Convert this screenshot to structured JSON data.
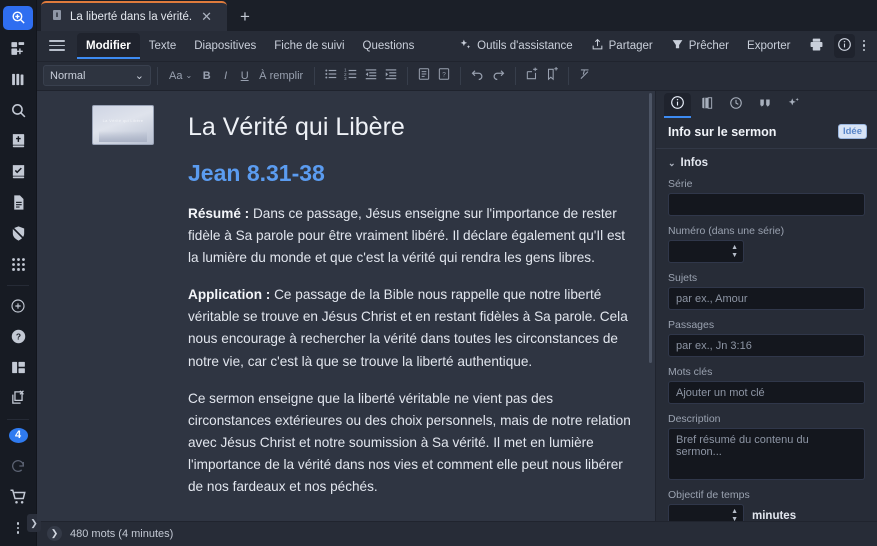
{
  "rail": {
    "items": [
      {
        "name": "search-logo-icon",
        "label": "Recherche"
      },
      {
        "name": "new-document-icon",
        "label": "Nouveau"
      },
      {
        "name": "library-icon",
        "label": "Bibliothèque"
      },
      {
        "name": "search-icon",
        "label": "Rechercher"
      },
      {
        "name": "bible-icon",
        "label": "Bible"
      },
      {
        "name": "checklist-icon",
        "label": "Tâches"
      },
      {
        "name": "document-icon",
        "label": "Documents"
      },
      {
        "name": "hidden-shield-icon",
        "label": "Masqué"
      },
      {
        "name": "apps-grid-icon",
        "label": "Applications"
      },
      {
        "name": "add-circle-icon",
        "label": "Ajouter"
      },
      {
        "name": "help-icon",
        "label": "Aide"
      },
      {
        "name": "layout-icon",
        "label": "Disposition"
      },
      {
        "name": "close-window-icon",
        "label": "Fermer"
      }
    ],
    "badge_count": "4",
    "sync_icon": "refresh-icon",
    "cart_icon": "cart-icon",
    "more_icon": "kebab-icon",
    "flyout_icon": "chevron-right-icon"
  },
  "tabstrip": {
    "tab_icon": "book-tab-icon",
    "tab_title": "La liberté dans la vérité.",
    "close_label": "✕",
    "add_label": "+",
    "accent_color": "#e07b3c"
  },
  "menubar": {
    "hamburger_name": "menu-icon",
    "items": [
      {
        "label": "Modifier",
        "active": true
      },
      {
        "label": "Texte",
        "active": false
      },
      {
        "label": "Diapositives",
        "active": false
      },
      {
        "label": "Fiche de suivi",
        "active": false
      },
      {
        "label": "Questions",
        "active": false
      }
    ],
    "right_buttons": [
      {
        "label": "Outils d'assistance",
        "icon": "sparkle-icon"
      },
      {
        "label": "Partager",
        "icon": "share-icon"
      },
      {
        "label": "Prêcher",
        "icon": "pulpit-icon"
      },
      {
        "label": "Exporter",
        "icon": ""
      }
    ],
    "print_icon": "printer-icon",
    "info_icon": "info-circle-icon",
    "overflow_icon": "kebab-icon"
  },
  "toolbar": {
    "style_value": "Normal",
    "style_caret": "⌄",
    "buttons": [
      {
        "name": "font-size-button",
        "glyph": "Aa",
        "type": "text"
      },
      {
        "name": "bold-button",
        "glyph": "B",
        "type": "text"
      },
      {
        "name": "italic-button",
        "glyph": "I",
        "type": "text"
      },
      {
        "name": "underline-button",
        "glyph": "U",
        "type": "text"
      },
      {
        "name": "fill-in-blank-button",
        "glyph": "À remplir",
        "type": "text"
      }
    ],
    "list_buttons": [
      {
        "name": "bullet-list-button"
      },
      {
        "name": "numbered-list-button"
      },
      {
        "name": "outdent-button"
      },
      {
        "name": "indent-button"
      }
    ],
    "block_buttons": [
      {
        "name": "note-block-button"
      },
      {
        "name": "question-block-button"
      }
    ],
    "history_buttons": [
      {
        "name": "undo-button"
      },
      {
        "name": "redo-button"
      }
    ],
    "insert_buttons": [
      {
        "name": "insert-slide-button"
      },
      {
        "name": "insert-bookmark-button"
      }
    ],
    "clear_format_button": {
      "name": "clear-formatting-button"
    }
  },
  "document": {
    "thumbnail_caption": "La Vérité qui Libère",
    "title": "La Vérité qui Libère",
    "reference": "Jean 8.31-38",
    "paragraphs": [
      {
        "lead": "Résumé :",
        "text": " Dans ce passage, Jésus enseigne sur l'importance de rester fidèle à Sa parole pour être vraiment libéré. Il déclare également qu'Il est la lumière du monde et que c'est la vérité qui rendra les gens libres."
      },
      {
        "lead": "Application :",
        "text": " Ce passage de la Bible nous rappelle que notre liberté véritable se trouve en Jésus Christ et en restant fidèles à Sa parole. Cela nous encourage à rechercher la vérité dans toutes les circonstances de notre vie, car c'est là que se trouve la liberté authentique."
      },
      {
        "lead": "",
        "text": "Ce sermon enseigne que la liberté véritable ne vient pas des circonstances extérieures ou des choix personnels, mais de notre relation avec Jésus Christ et notre soumission à Sa vérité. Il met en lumière l'importance de la vérité dans nos vies et comment elle peut nous libérer de nos fardeaux et nos péchés."
      }
    ]
  },
  "panel": {
    "tabs": [
      {
        "name": "tab-sermon-info",
        "icon": "info-circle-icon",
        "active": true
      },
      {
        "name": "tab-notebook",
        "icon": "notebook-icon",
        "active": false
      },
      {
        "name": "tab-history",
        "icon": "clock-icon",
        "active": false
      },
      {
        "name": "tab-quotes",
        "icon": "quote-icon",
        "active": false
      },
      {
        "name": "tab-assistant",
        "icon": "sparkle-icon",
        "active": false
      }
    ],
    "title": "Info sur le sermon",
    "badge": "Idée",
    "section_label": "Infos",
    "section_chevron": "⌄",
    "fields": [
      {
        "name": "series-field",
        "label": "Série",
        "value": "",
        "placeholder": "",
        "type": "text"
      },
      {
        "name": "series-number-field",
        "label": "Numéro (dans une série)",
        "value": "",
        "placeholder": "",
        "type": "number"
      },
      {
        "name": "topics-field",
        "label": "Sujets",
        "value": "",
        "placeholder": "par ex., Amour",
        "type": "text"
      },
      {
        "name": "passages-field",
        "label": "Passages",
        "value": "",
        "placeholder": "par ex., Jn 3:16",
        "type": "text"
      },
      {
        "name": "keywords-field",
        "label": "Mots clés",
        "value": "",
        "placeholder": "Ajouter un mot clé",
        "type": "text"
      },
      {
        "name": "description-field",
        "label": "Description",
        "value": "",
        "placeholder": "Bref résumé du contenu du sermon...",
        "type": "textarea"
      },
      {
        "name": "time-goal-field",
        "label": "Objectif de temps",
        "value": "",
        "placeholder": "",
        "type": "number",
        "unit": "minutes"
      }
    ]
  },
  "statusbar": {
    "expand_icon": "chevron-right-icon",
    "word_count": "480 mots (4 minutes)"
  }
}
